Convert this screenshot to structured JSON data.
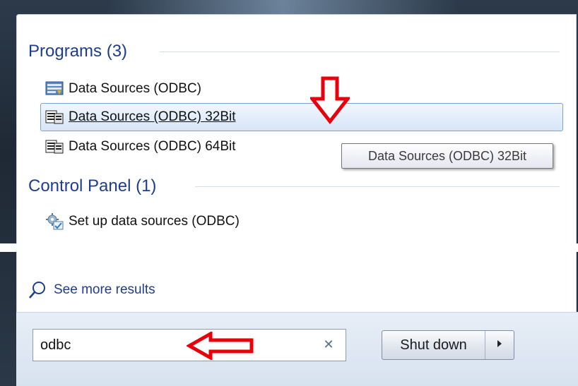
{
  "sections": {
    "programs": {
      "header": "Programs (3)",
      "items": [
        {
          "label": "Data Sources (ODBC)",
          "icon": "odbc-admin-icon"
        },
        {
          "label": "Data Sources (ODBC) 32Bit",
          "icon": "odbc-32bit-icon",
          "selected": true
        },
        {
          "label": "Data Sources (ODBC) 64Bit",
          "icon": "odbc-64bit-icon"
        }
      ]
    },
    "control_panel": {
      "header": "Control Panel (1)",
      "items": [
        {
          "label": "Set up data sources (ODBC)",
          "icon": "control-panel-gear-icon"
        }
      ]
    }
  },
  "tooltip": "Data Sources (ODBC) 32Bit",
  "see_more": "See more results",
  "search": {
    "value": "odbc"
  },
  "shutdown": {
    "label": "Shut down"
  },
  "annotations": {
    "arrow_color": "#e8000b"
  },
  "colors": {
    "header": "#1e3d8a",
    "selection_border": "#7da2ce"
  }
}
